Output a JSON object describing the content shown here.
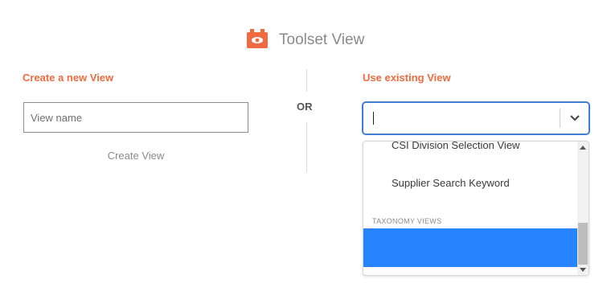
{
  "header": {
    "title": "Toolset View",
    "logo_icon": "toolset-eye-icon",
    "logo_color": "#f06a40"
  },
  "left": {
    "label": "Create a new View",
    "input_placeholder": "View name",
    "input_value": "",
    "create_label": "Create View"
  },
  "divider": {
    "or_label": "OR"
  },
  "right": {
    "label": "Use existing View",
    "select_value": "",
    "dropdown_icon": "chevron-down-icon",
    "options": [
      {
        "label": "CSI Division Selection View"
      },
      {
        "label": "Supplier Search Keyword"
      }
    ],
    "group_label": "TAXONOMY VIEWS",
    "highlight_color": "#2684ff"
  },
  "colors": {
    "accent": "#f06a40",
    "focus_border": "#3f7dd6",
    "muted_text": "#8a8a8a"
  }
}
